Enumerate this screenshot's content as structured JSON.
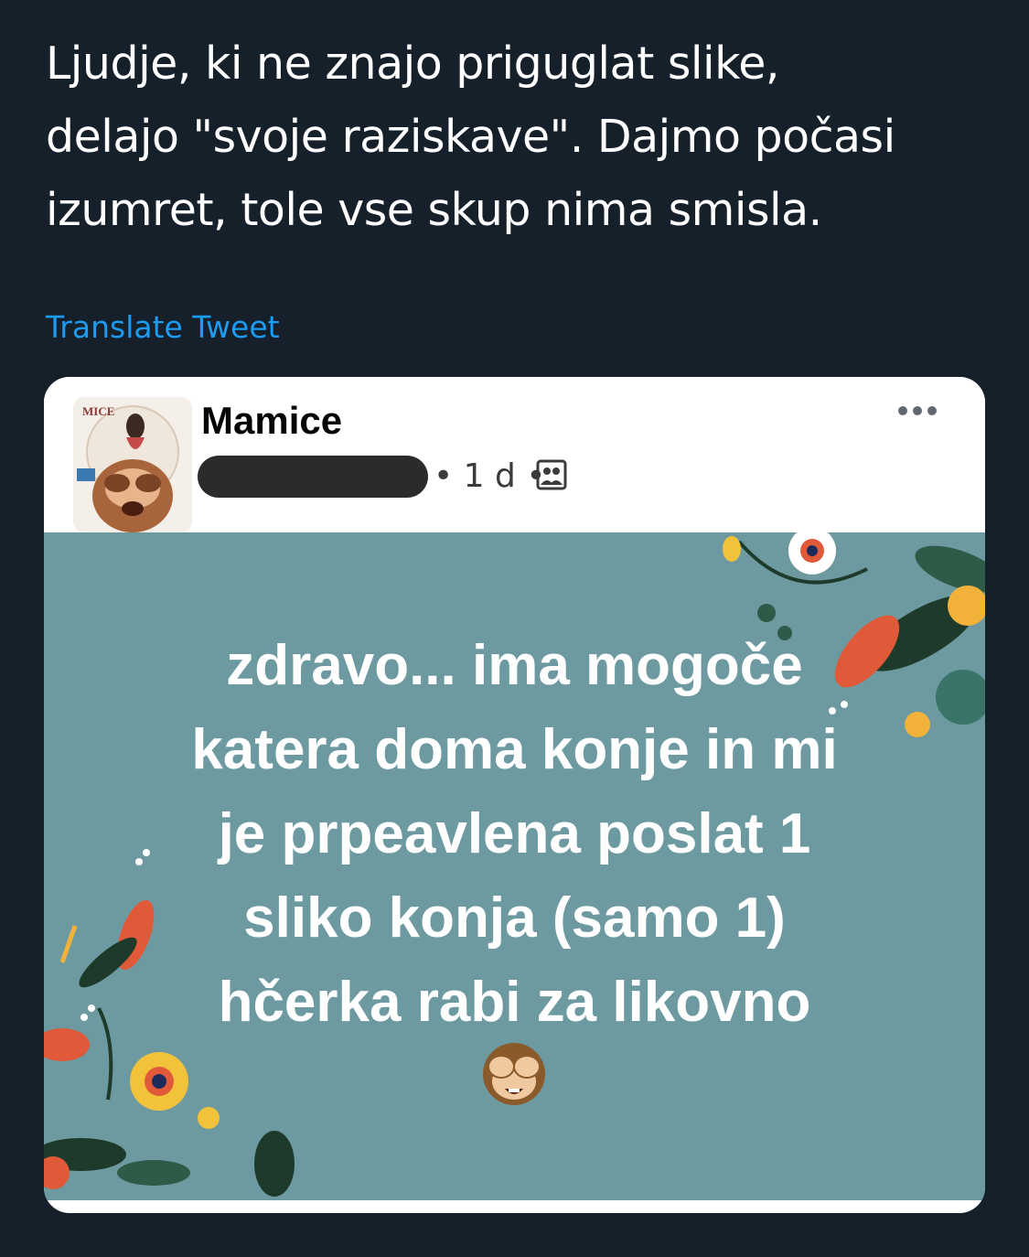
{
  "tweet": {
    "text": "Ljudje, ki ne znajo priguglat slike,\ndelajo \"svoje raziskave\". Dajmo počasi\nizumret, tole vse skup nima smisla.",
    "translate_label": "Translate Tweet"
  },
  "fb_post": {
    "author": "Mamice",
    "meta_time": "• 1 d •",
    "body": "zdravo... ima mogoče\nkatera doma konje in mi\nje prpeavlena poslat 1\nsliko konja (samo 1)\nhčerka rabi za likovno",
    "emoji": "see-no-evil-monkey",
    "more_icon": "more-horizontal-icon",
    "audience_icon": "friends-audience-icon",
    "avatar_text": "MICE"
  },
  "colors": {
    "background": "#15202b",
    "link": "#1d9bf0",
    "post_bg": "#6c9aa0"
  }
}
